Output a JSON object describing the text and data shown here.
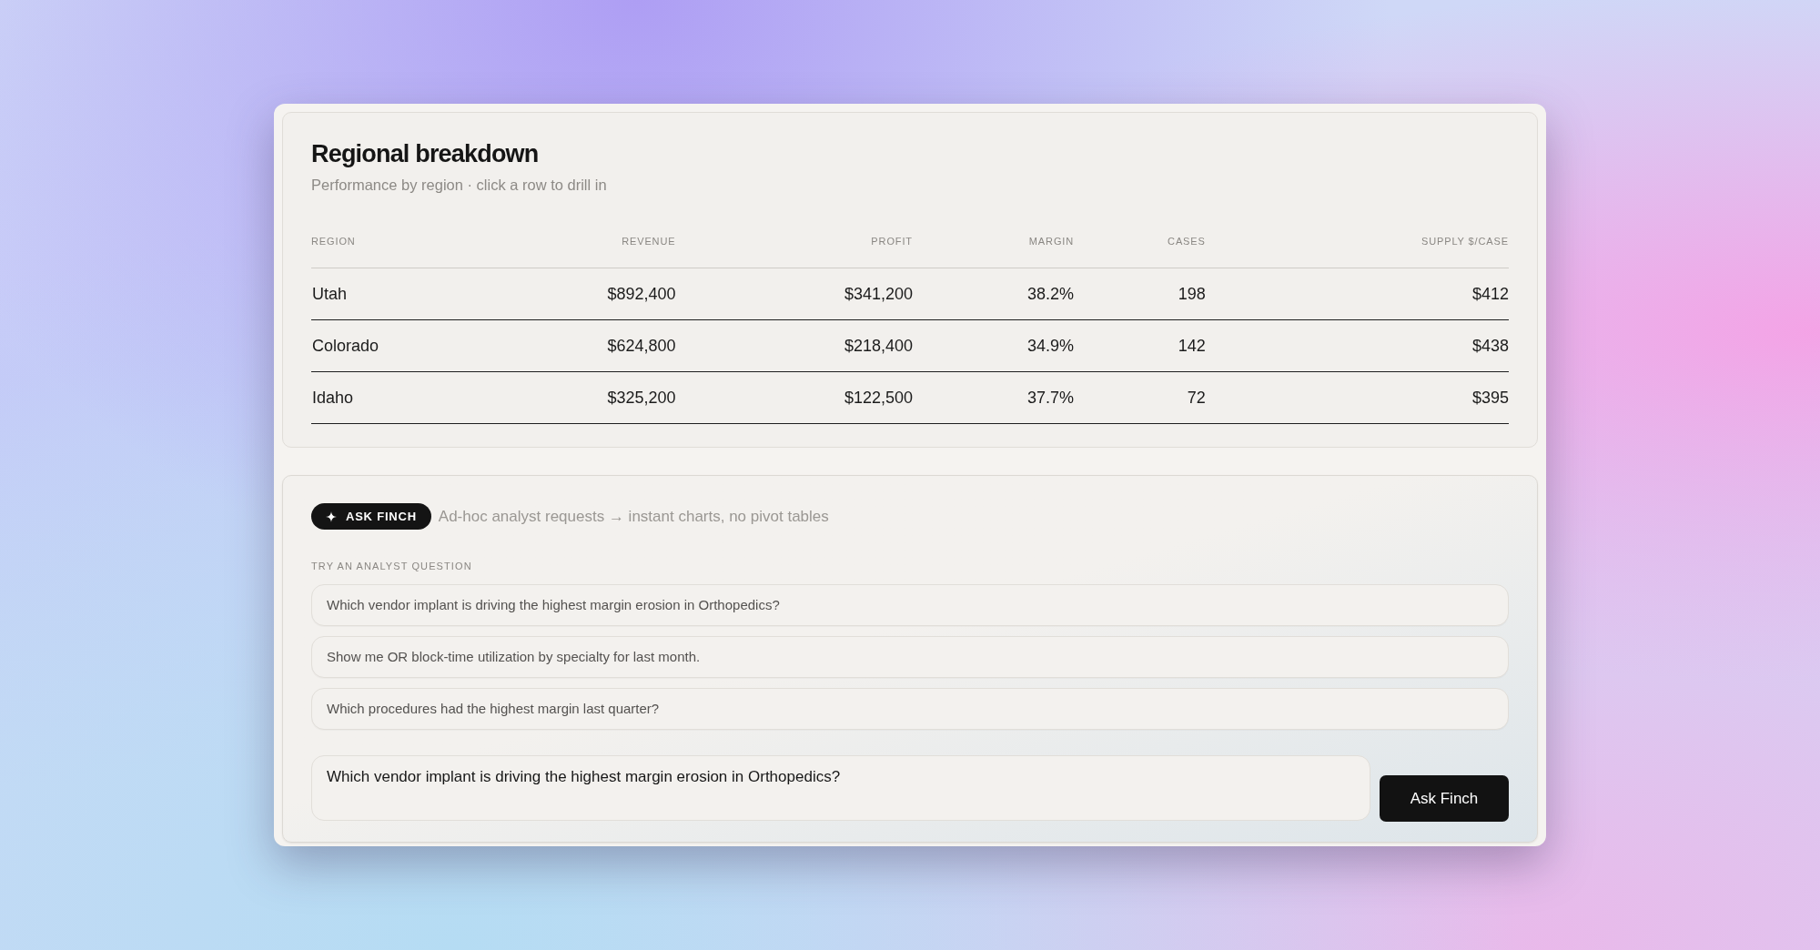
{
  "regional_breakdown": {
    "title": "Regional breakdown",
    "subtitle": "Performance by region · click a row to drill in",
    "table": {
      "columns": [
        "REGION",
        "REVENUE",
        "PROFIT",
        "MARGIN",
        "CASES",
        "SUPPLY $/CASE"
      ],
      "rows": [
        {
          "cells": [
            "Utah",
            "$892,400",
            "$341,200",
            "38.2%",
            "198",
            "$412"
          ]
        },
        {
          "cells": [
            "Colorado",
            "$624,800",
            "$218,400",
            "34.9%",
            "142",
            "$438"
          ]
        },
        {
          "cells": [
            "Idaho",
            "$325,200",
            "$122,500",
            "37.7%",
            "72",
            "$395"
          ]
        }
      ]
    }
  },
  "ask_finch": {
    "badge": "ASK FINCH",
    "tagline": "Ad-hoc analyst requests → instant charts, no pivot tables",
    "suggestions_label": "TRY AN ANALYST QUESTION",
    "suggestions": [
      "Which vendor implant is driving the highest margin erosion in Orthopedics?",
      "Show me OR block-time utilization by specialty for last month.",
      "Which procedures had the highest margin last quarter?"
    ],
    "input": {
      "value": "Which vendor implant is driving the highest margin erosion in Orthopedics?"
    },
    "submit_button": "Ask Finch"
  }
}
